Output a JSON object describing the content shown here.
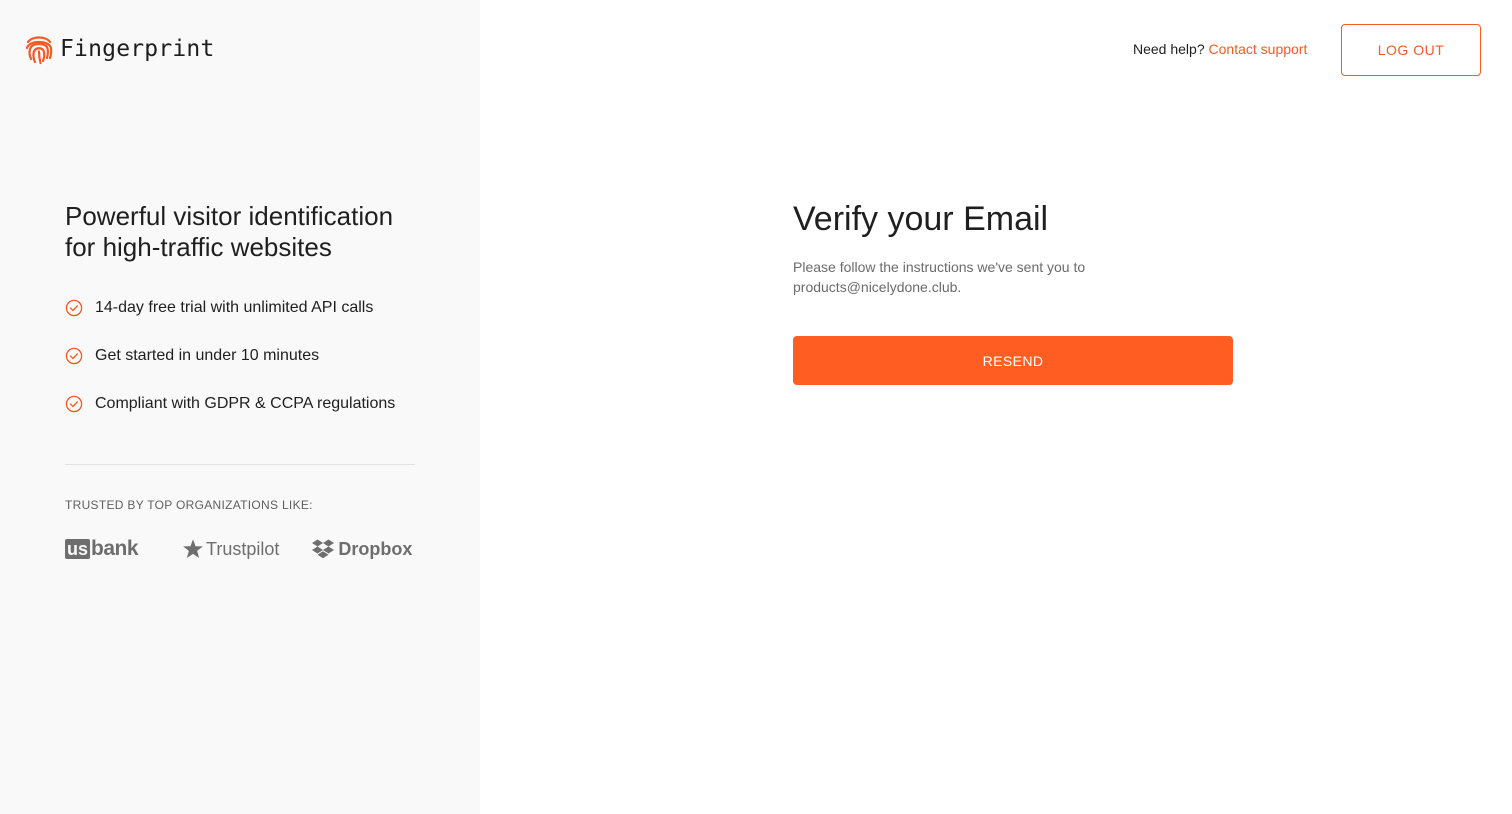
{
  "brand": {
    "name": "Fingerprint",
    "logo_icon": "fingerprint-icon",
    "accent_color": "#f35b22"
  },
  "header": {
    "help_text": "Need help?",
    "help_link": "Contact support",
    "logout_label": "LOG OUT"
  },
  "left": {
    "headline": "Powerful visitor identification for high-traffic websites",
    "features": [
      {
        "icon": "check-circle-icon",
        "label": "14-day free trial with unlimited API calls"
      },
      {
        "icon": "check-circle-icon",
        "label": "Get started in under 10 minutes"
      },
      {
        "icon": "check-circle-icon",
        "label": "Compliant with GDPR & CCPA regulations"
      }
    ],
    "trusted_title": "TRUSTED BY TOP ORGANIZATIONS LIKE:",
    "brands": {
      "usbank_us": "us",
      "usbank_bank": "bank",
      "trustpilot": "Trustpilot",
      "dropbox": "Dropbox"
    }
  },
  "main": {
    "title": "Verify your Email",
    "description": "Please follow the instructions we've sent you to products@nicelydone.club.",
    "resend_label": "RESEND",
    "button_color": "#ff5d22"
  }
}
